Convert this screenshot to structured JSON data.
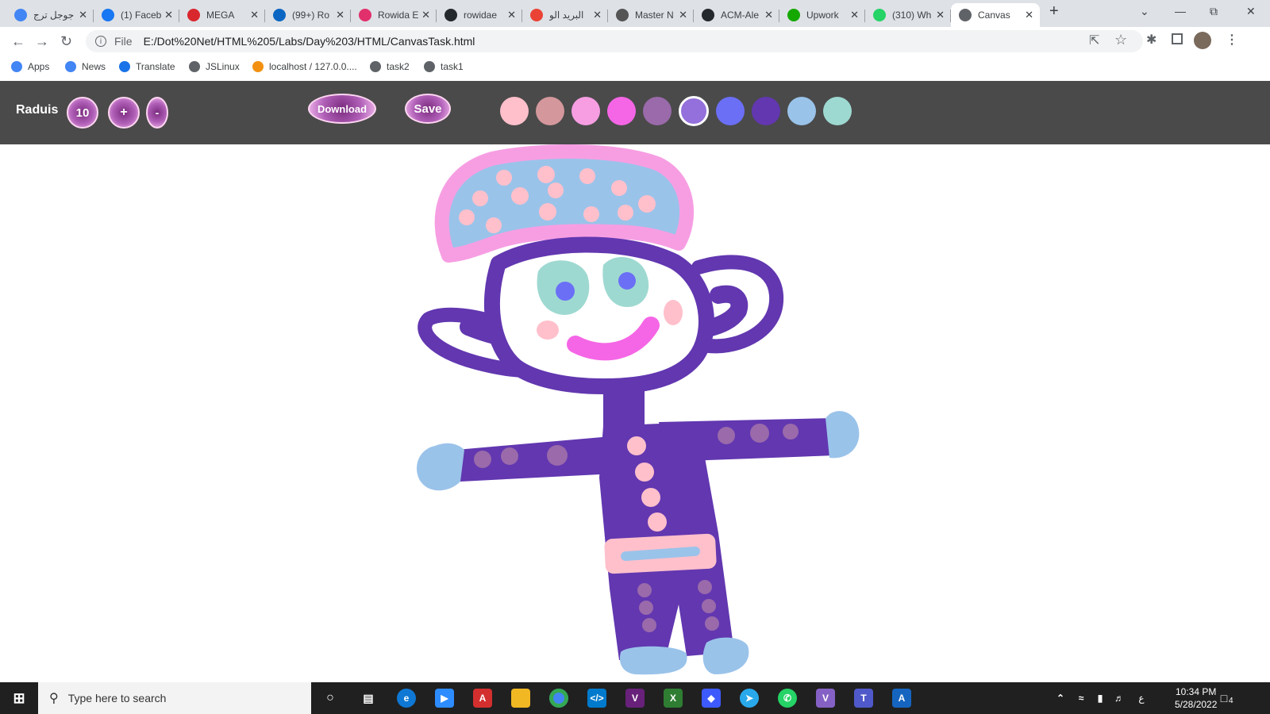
{
  "browser": {
    "tabs": [
      {
        "title": "جوجل ترج",
        "icon": "google-icon",
        "color": "#4285f4",
        "active": false
      },
      {
        "title": "(1) Faceb",
        "icon": "facebook-icon",
        "color": "#1877f2",
        "active": false
      },
      {
        "title": "MEGA",
        "icon": "mega-icon",
        "color": "#d9272e",
        "active": false
      },
      {
        "title": "(99+) Ro",
        "icon": "linkedin-icon",
        "color": "#0a66c2",
        "active": false
      },
      {
        "title": "Rowida E",
        "icon": "instagram-icon",
        "color": "#e1306c",
        "active": false
      },
      {
        "title": "rowidae",
        "icon": "github-icon",
        "color": "#24292e",
        "active": false
      },
      {
        "title": "البريد الو",
        "icon": "gmail-icon",
        "color": "#ea4335",
        "active": false
      },
      {
        "title": "Master N",
        "icon": "master-icon",
        "color": "#555555",
        "active": false
      },
      {
        "title": "ACM-Ale",
        "icon": "github-icon",
        "color": "#24292e",
        "active": false
      },
      {
        "title": "Upwork",
        "icon": "upwork-icon",
        "color": "#14a800",
        "active": false
      },
      {
        "title": "(310) Wh",
        "icon": "whatsapp-icon",
        "color": "#25d366",
        "active": false
      },
      {
        "title": "Canvas",
        "icon": "globe-icon",
        "color": "#5f6368",
        "active": true
      }
    ],
    "new_tab_label": "+",
    "address": {
      "scheme": "File",
      "url": "E:/Dot%20Net/HTML%205/Labs/Day%203/HTML/CanvasTask.html"
    },
    "bookmarks": [
      {
        "label": "Apps",
        "icon": "apps-grid-icon"
      },
      {
        "label": "News",
        "icon": "news-icon"
      },
      {
        "label": "Translate",
        "icon": "translate-icon"
      },
      {
        "label": "JSLinux",
        "icon": "globe-icon"
      },
      {
        "label": "localhost / 127.0.0....",
        "icon": "phpmyadmin-icon"
      },
      {
        "label": "task2",
        "icon": "globe-icon"
      },
      {
        "label": "task1",
        "icon": "globe-icon"
      }
    ]
  },
  "app": {
    "radius_label": "Raduis",
    "radius_value": "10",
    "plus_label": "+",
    "minus_label": "-",
    "download_label": "Download",
    "save_label": "Save",
    "palette": [
      "#ffc0cb",
      "#d4989c",
      "#f79ee3",
      "#f566e6",
      "#9a6aaa",
      "#9370db",
      "#6b6ff6",
      "#6237b0",
      "#9ac3ea",
      "#9ed9d1"
    ],
    "selected_color": "#9370db"
  },
  "taskbar": {
    "search_placeholder": "Type here to search",
    "time": "10:34 PM",
    "date": "5/28/2022",
    "language": "ع",
    "notifications": "4"
  }
}
